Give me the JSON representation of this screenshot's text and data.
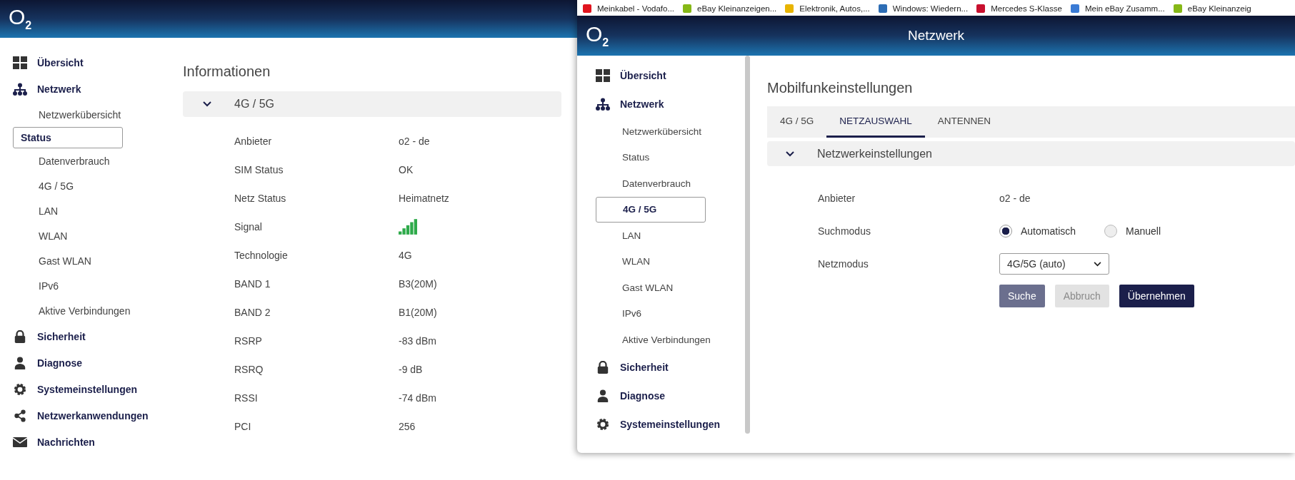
{
  "left_window": {
    "logo": "O$_{2}$",
    "sidebar": {
      "items": [
        {
          "label": "Übersicht"
        },
        {
          "label": "Netzwerk",
          "children": [
            {
              "label": "Netzwerkübersicht",
              "selected": false
            },
            {
              "label": "Status",
              "selected": true
            },
            {
              "label": "Datenverbrauch",
              "selected": false
            },
            {
              "label": "4G / 5G",
              "selected": false
            },
            {
              "label": "LAN",
              "selected": false
            },
            {
              "label": "WLAN",
              "selected": false
            },
            {
              "label": "Gast WLAN",
              "selected": false
            },
            {
              "label": "IPv6",
              "selected": false
            },
            {
              "label": "Aktive Verbindungen",
              "selected": false
            }
          ]
        },
        {
          "label": "Sicherheit"
        },
        {
          "label": "Diagnose"
        },
        {
          "label": "Systemeinstellungen"
        },
        {
          "label": "Netzwerkanwendungen"
        },
        {
          "label": "Nachrichten"
        }
      ]
    },
    "heading": "Informationen",
    "section": {
      "title": "4G / 5G",
      "expanded": true
    },
    "rows": [
      {
        "kind": "text",
        "label": "Anbieter",
        "value": "o2 - de"
      },
      {
        "kind": "text",
        "label": "SIM Status",
        "value": "OK"
      },
      {
        "kind": "text",
        "label": "Netz Status",
        "value": "Heimatnetz"
      },
      {
        "kind": "signal",
        "label": "Signal"
      },
      {
        "kind": "text",
        "label": "Technologie",
        "value": "4G"
      },
      {
        "kind": "text",
        "label": "BAND 1",
        "value": "B3(20M)"
      },
      {
        "kind": "text",
        "label": "BAND 2",
        "value": "B1(20M)"
      },
      {
        "kind": "text",
        "label": "RSRP",
        "value": "-83 dBm"
      },
      {
        "kind": "text",
        "label": "RSRQ",
        "value": "-9 dB"
      },
      {
        "kind": "text",
        "label": "RSSI",
        "value": "-74 dBm"
      },
      {
        "kind": "text",
        "label": "PCI",
        "value": "256"
      }
    ]
  },
  "right_window": {
    "bookmarks": [
      {
        "label": "Meinkabel - Vodafo..."
      },
      {
        "label": "eBay Kleinanzeigen..."
      },
      {
        "label": "Elektronik, Autos,..."
      },
      {
        "label": "Windows: Wiedern..."
      },
      {
        "label": "Mercedes S-Klasse"
      },
      {
        "label": "Mein eBay Zusamm..."
      },
      {
        "label": "eBay Kleinanzeig"
      }
    ],
    "logo": "O$_{2}$",
    "title": "Netzwerk",
    "sidebar": {
      "items": [
        {
          "label": "Übersicht"
        },
        {
          "label": "Netzwerk",
          "children": [
            {
              "label": "Netzwerkübersicht",
              "selected": false
            },
            {
              "label": "Status",
              "selected": false
            },
            {
              "label": "Datenverbrauch",
              "selected": false
            },
            {
              "label": "4G / 5G",
              "selected": true
            },
            {
              "label": "LAN",
              "selected": false
            },
            {
              "label": "WLAN",
              "selected": false
            },
            {
              "label": "Gast WLAN",
              "selected": false
            },
            {
              "label": "IPv6",
              "selected": false
            },
            {
              "label": "Aktive Verbindungen",
              "selected": false
            }
          ]
        },
        {
          "label": "Sicherheit"
        },
        {
          "label": "Diagnose"
        },
        {
          "label": "Systemeinstellungen"
        }
      ]
    },
    "heading": "Mobilfunkeinstellungen",
    "tabs": [
      {
        "label": "4G / 5G",
        "selected": false
      },
      {
        "label": "NETZAUSWAHL",
        "selected": true
      },
      {
        "label": "ANTENNEN",
        "selected": false
      }
    ],
    "section": {
      "title": "Netzwerkeinstellungen",
      "expanded": true
    },
    "fields": [
      {
        "kind": "text",
        "label": "Anbieter",
        "value": "o2 - de"
      },
      {
        "kind": "radio",
        "label": "Suchmodus",
        "options": [
          {
            "label": "Automatisch",
            "selected": true
          },
          {
            "label": "Manuell",
            "selected": false
          }
        ]
      },
      {
        "kind": "select",
        "label": "Netzmodus",
        "value": "4G/5G (auto)"
      }
    ],
    "buttons": [
      {
        "label": "Suche",
        "kind": "secondary",
        "disabled": false
      },
      {
        "label": "Abbruch",
        "kind": "secondary",
        "disabled": true
      },
      {
        "label": "Übernehmen",
        "kind": "primary",
        "disabled": false
      }
    ]
  }
}
